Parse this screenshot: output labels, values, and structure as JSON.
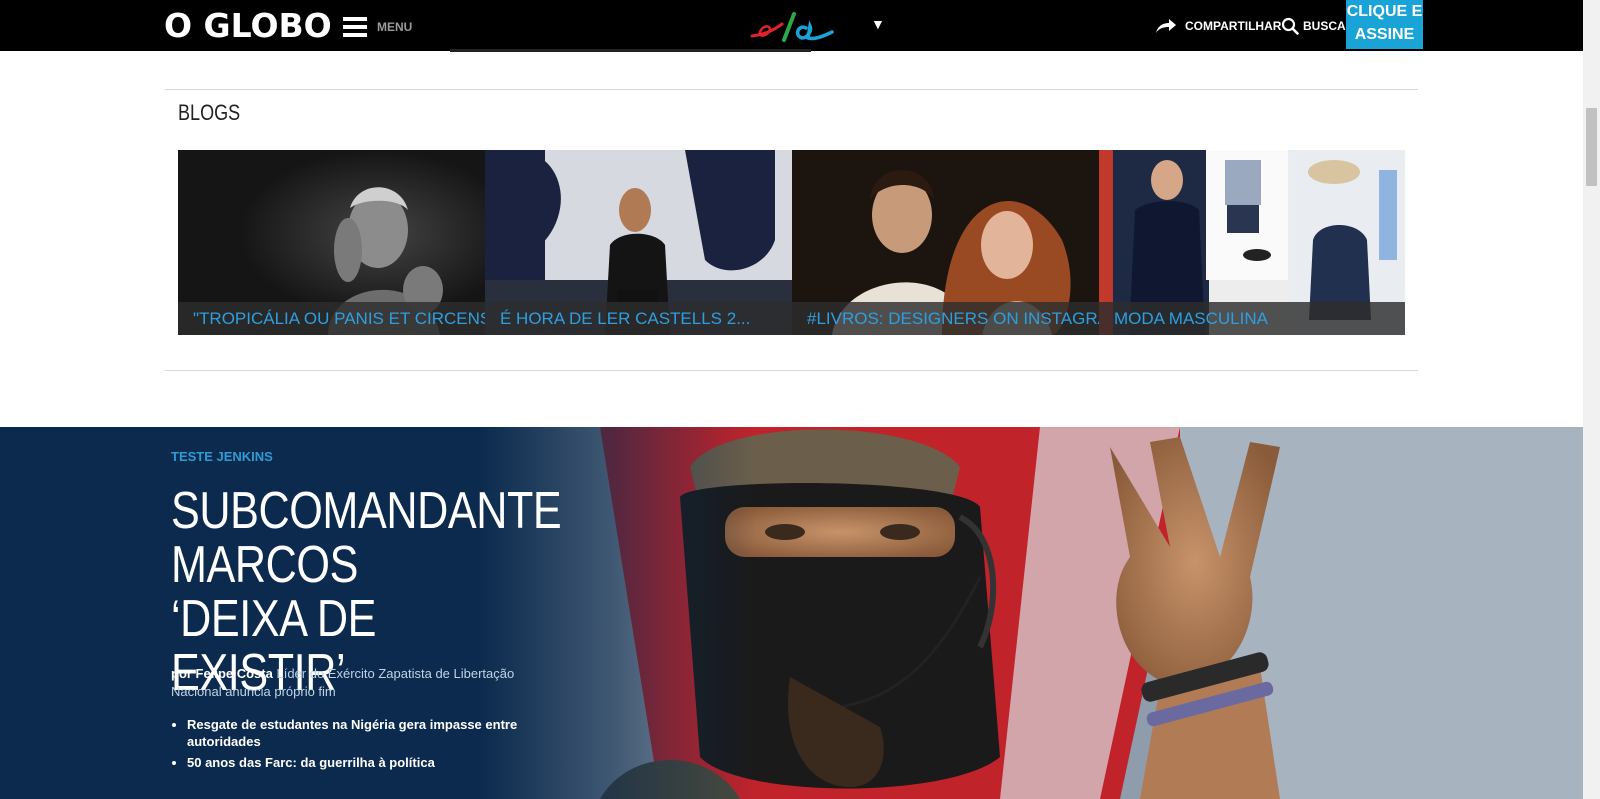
{
  "header": {
    "logo_text": "O GLOBO",
    "menu_label": "MENU",
    "section_logo": "ela",
    "share_label": "COMPARTILHAR",
    "search_label": "BUSCAR",
    "subscribe_line1": "CLIQUE E",
    "subscribe_line2": "ASSINE"
  },
  "blogs": {
    "title": "BLOGS",
    "cards": [
      {
        "caption": "\"TROPICÁLIA OU PANIS ET CIRCENSIS\""
      },
      {
        "caption": "É HORA DE LER CASTELLS 2..."
      },
      {
        "caption": "#LIVROS: DESIGNERS ON INSTAGRAM #FASHION - SERA"
      },
      {
        "caption": "MODA MASCULINA"
      }
    ]
  },
  "feature": {
    "kicker": "TESTE JENKINS",
    "headline": "SUBCOMANDANTE MARCOS ‘DEIXA DE EXISTIR’",
    "byline_prefix": "por Felipe Costa",
    "byline_text": "Líder do Exército Zapatista de Libertação Nacional anuncia próprio fim",
    "bullets": [
      "Resgate de estudantes na Nigéria gera impasse entre autoridades",
      "50 anos das Farc: da guerrilha à política"
    ]
  },
  "colors": {
    "topbar": "#000000",
    "accent_blue": "#1aa3d6",
    "feature_bg": "#0b2a4d",
    "link_blue": "#2d9fe0"
  }
}
